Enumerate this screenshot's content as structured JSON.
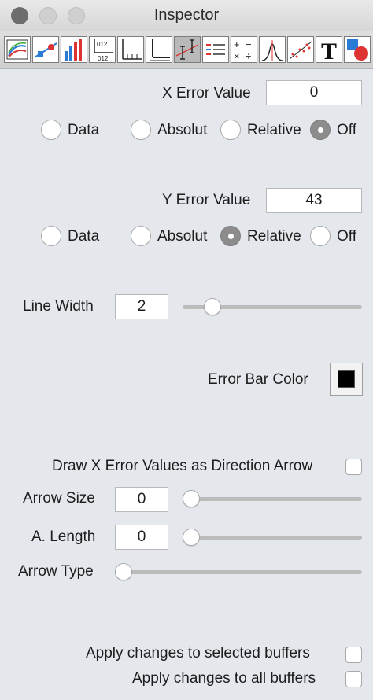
{
  "window": {
    "title": "Inspector"
  },
  "toolbar": {
    "tools": [
      {
        "icon": "plot-style-icon"
      },
      {
        "icon": "line-marker-icon"
      },
      {
        "icon": "bar-chart-icon"
      },
      {
        "icon": "axis-ticks-icon"
      },
      {
        "icon": "axis-scale-icon"
      },
      {
        "icon": "axis-frame-icon"
      },
      {
        "icon": "error-bars-icon",
        "active": true
      },
      {
        "icon": "legend-list-icon"
      },
      {
        "icon": "math-operations-icon"
      },
      {
        "icon": "curve-fit-icon"
      },
      {
        "icon": "regression-line-icon"
      },
      {
        "icon": "text-tool-icon",
        "text": "T"
      },
      {
        "icon": "shapes-icon"
      }
    ]
  },
  "x_error": {
    "label": "X Error Value",
    "value": "0",
    "options": [
      "Data",
      "Absolut",
      "Relative",
      "Off"
    ],
    "selected": "Off"
  },
  "y_error": {
    "label": "Y Error Value",
    "value": "43",
    "options": [
      "Data",
      "Absolut",
      "Relative",
      "Off"
    ],
    "selected": "Relative"
  },
  "line_width": {
    "label": "Line Width",
    "value": "2",
    "slider_fraction": 0.13
  },
  "error_bar_color": {
    "label": "Error Bar Color",
    "color": "#000000"
  },
  "arrow": {
    "direction_label": "Draw X Error Values as Direction Arrow",
    "direction_checked": false,
    "size_label": "Arrow Size",
    "size_value": "0",
    "size_fraction": 0,
    "length_label": "A. Length",
    "length_value": "0",
    "length_fraction": 0,
    "type_label": "Arrow Type",
    "type_fraction": 0
  },
  "apply": {
    "selected_label": "Apply changes to selected buffers",
    "selected_checked": false,
    "all_label": "Apply changes to all buffers",
    "all_checked": false
  }
}
